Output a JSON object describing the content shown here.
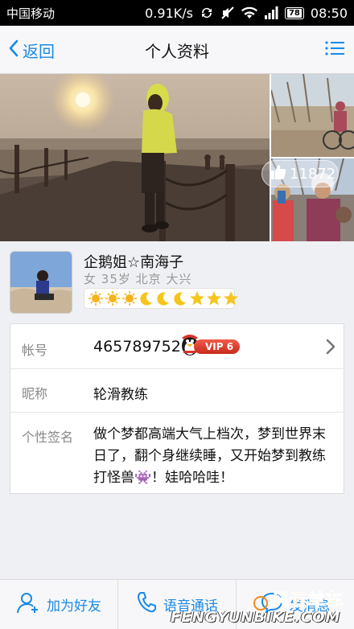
{
  "status_bar": {
    "carrier": "中国移动",
    "speed": "0.91K/s",
    "battery": "78",
    "time": "08:50"
  },
  "nav": {
    "back_label": "返回",
    "title": "个人资料"
  },
  "photos": {
    "like_count": "11872"
  },
  "profile": {
    "nickname": "企鹅姐☆南海子",
    "gender": "女",
    "age": "35岁",
    "city": "北京",
    "district": "大兴",
    "level_icons": [
      "sun",
      "sun",
      "sun",
      "moon",
      "moon",
      "moon",
      "star",
      "star",
      "star"
    ]
  },
  "info": {
    "account_label": "帐号",
    "account_value": "465789752",
    "vip_label": "VIP 6",
    "nick_label": "昵称",
    "nick_value": "轮滑教练",
    "sign_label": "个性签名",
    "sign_value": "做个梦都高端大气上档次，梦到世界末日了，翻个身继续睡，又开始梦到教练打怪兽👾！娃哈哈哇！"
  },
  "toolbar": {
    "add_friend": "加为好友",
    "voice_call": "语音通话",
    "send_message": "发消息"
  },
  "watermark": {
    "logo_text": "风云单车",
    "site": "FENGYUNBIKE.COM"
  },
  "colors": {
    "accent": "#1a8ae6",
    "background": "#eff0f4",
    "vip_red": "#d8362a"
  }
}
